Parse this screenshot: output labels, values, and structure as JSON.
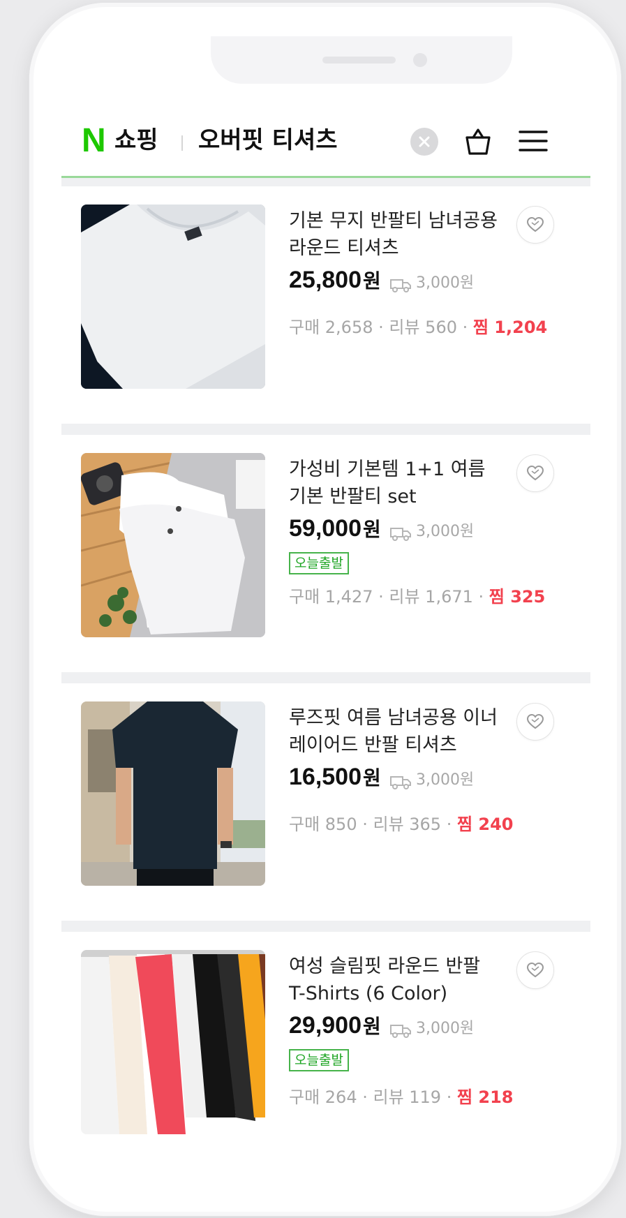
{
  "header": {
    "logo_letter": "N",
    "brand": "쇼핑",
    "query": "오버핏 티셔츠"
  },
  "labels": {
    "today_badge": "오늘출발"
  },
  "colors": {
    "brand_green": "#1ec800",
    "zzim_red": "#f2414e",
    "badge_green": "#1ea523"
  },
  "products": [
    {
      "title_line1": "기본 무지 반팔티 남녀공용",
      "title_line2": "라운드 티셔츠",
      "price": "25,800",
      "won": "원",
      "shipping": "3,000원",
      "badge": "",
      "stats_prefix": "구매 2,658 · 리뷰 560 · ",
      "zzim": "찜 1,204"
    },
    {
      "title_line1": "가성비 기본템 1+1 여름",
      "title_line2": "기본 반팔티 set",
      "price": "59,000",
      "won": "원",
      "shipping": "3,000원",
      "badge": "오늘출발",
      "stats_prefix": "구매 1,427 · 리뷰 1,671 · ",
      "zzim": "찜 325"
    },
    {
      "title_line1": "루즈핏 여름 남녀공용 이너",
      "title_line2": "레이어드 반팔 티셔츠",
      "price": "16,500",
      "won": "원",
      "shipping": "3,000원",
      "badge": "",
      "stats_prefix": "구매 850 · 리뷰 365 · ",
      "zzim": "찜 240"
    },
    {
      "title_line1": "여성 슬림핏 라운드 반팔",
      "title_line2": "T-Shirts (6 Color)",
      "price": "29,900",
      "won": "원",
      "shipping": "3,000원",
      "badge": "오늘출발",
      "stats_prefix": "구매 264 · 리뷰 119 · ",
      "zzim": "찜 218"
    }
  ],
  "icons": {
    "clear": "close-circle-icon",
    "cart": "shopping-bag-icon",
    "menu": "hamburger-menu-icon",
    "wish": "heart-icon",
    "shipping": "truck-icon"
  }
}
